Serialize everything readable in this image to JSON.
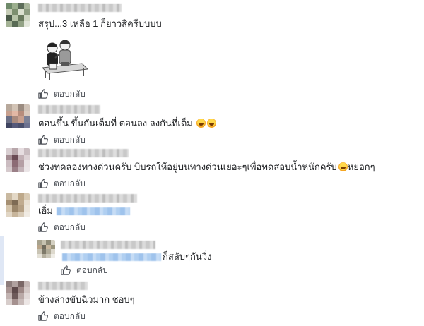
{
  "comments": [
    {
      "text": "สรุป...3 เหลือ 1 ก็ยาวสิครีบบบบ",
      "has_sticker": true,
      "sticker_icon": "sticker-two-boys-on-bench"
    },
    {
      "text": "ตอนขึ้น ขึ้นกันเต็มที่ ตอนลง ลงกันที่เต็ม",
      "emoji": "rofl-emoji"
    },
    {
      "text_before": "ช่วงทดลองทางด่วนครับ บีบรถให้อยู่บนทางด่วนเยอะๆเพื่อทดสอบน้ำหนักครับ",
      "text_after": "หยอกๆ",
      "emoji": "rofl-emoji"
    },
    {
      "text": "เอิ่ม",
      "has_tagged_link": true,
      "reply": {
        "text_after_link": "ก็สลับๆกันวิ่ง"
      }
    },
    {
      "text": "ข้างล่างขับฉิวมาก ชอบๆ"
    }
  ],
  "labels": {
    "reply": "ตอบกลับ"
  },
  "icons": {
    "like": "like-icon"
  },
  "colors": {
    "action_text": "#4b4f56",
    "link_blur": "#9fc3ec"
  }
}
